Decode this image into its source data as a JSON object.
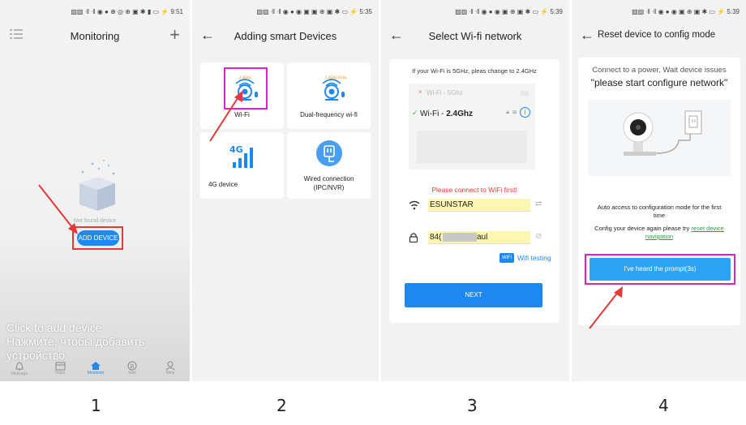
{
  "screens": [
    {
      "status": "▨▨ ᐧ‖ ᐧ‖ ◉ ● ⊕ ◎ ⊕ ▣ ✱ ▮ ▭ ⚡ 9:51",
      "title": "Monitoring",
      "empty_text": "Not found device",
      "add_button": "ADD DEVICE",
      "caption_lines": [
        "Click to add device",
        "Нажмите, чтобы добавить",
        "устройство"
      ],
      "tabs": [
        "Message",
        "Video",
        "Monitorin",
        "Mall",
        "Mine"
      ],
      "step": "1"
    },
    {
      "status": "▨▨ ᐧ‖ ᐧ‖ ◉ ● ◉ ▣ ▣ ⊕ ▣ ✱ ▭ ⚡ 5:35",
      "title": "Adding smart Devices",
      "badge_label": "2.4GHz",
      "badge_label_dual": "2.4GHz 5GHz",
      "signal_label": "4G",
      "options": [
        "Wi-Fi",
        "Dual-frequency wi-fi",
        "4G device",
        "Wired connection\n(IPC/NVR)"
      ],
      "step": "2"
    },
    {
      "status": "▨▨ ᐧ‖ ᐧ‖ ◉ ● ◉ ▣ ⊕ ▣ ✱ ▭ ⚡ 5:39",
      "title": "Select Wi-fi network",
      "hint": "If your Wi-Fi is 5GHz,  pleas change to 2.4GHz",
      "wifi_5g": "Wi-Fi - 5Ghz",
      "wifi_24_prefix": "Wi-Fi - ",
      "wifi_24_bold": "2.4Ghz",
      "warning": "Please connect to WiFi first!",
      "ssid": "ESUNSTAR",
      "password_start": "84(",
      "password_end": "aul",
      "wifi_badge": "WiFi",
      "wifi_testing": "Wifi testing",
      "next": "NEXT",
      "step": "3"
    },
    {
      "status": "▨▨ ᐧ‖ ᐧ‖ ◉ ● ◉ ▣ ⊕ ▣ ✱ ▭ ⚡ 5:39",
      "title": "Reset device to config mode",
      "line1": "Connect to a power,  Wait device issues",
      "line2": "\"please start configure network\"",
      "auto1": "Auto access to configuration mode for the first",
      "auto2": "time",
      "config_text": "Config your device again please try ",
      "config_link1": "reset device",
      "config_link2": "navigation",
      "heard": "I've heard the prompt(3s)",
      "step": "4"
    }
  ],
  "colors": {
    "primary": "#1e88f0",
    "highlight": "#e020c8",
    "red": "#e53935",
    "yellow": "#fbf6b0"
  }
}
